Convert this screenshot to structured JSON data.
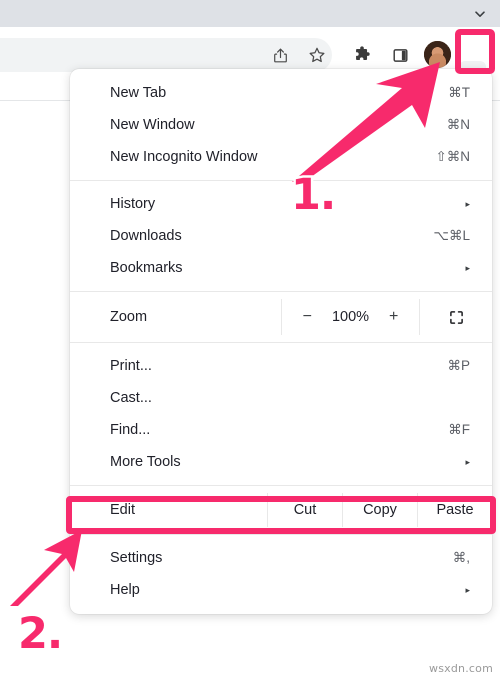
{
  "browser": {
    "tabstrip": {
      "chevron_icon": "chevron-down-icon"
    },
    "toolbar": {
      "icons": [
        {
          "name": "share-icon",
          "label": "Share"
        },
        {
          "name": "bookmark-star-icon",
          "label": "Bookmark this tab"
        },
        {
          "name": "extensions-puzzle-icon",
          "label": "Extensions"
        },
        {
          "name": "side-panel-icon",
          "label": "Side panel"
        }
      ],
      "avatar_label": "Profile",
      "menu_button_label": "Customize and control Google Chrome",
      "menu_button_icon": "three-dots-vertical-icon"
    }
  },
  "menu": {
    "groups": [
      {
        "items": [
          {
            "label": "New Tab",
            "accel": "⌘T",
            "caret": ""
          },
          {
            "label": "New Window",
            "accel": "⌘N",
            "caret": ""
          },
          {
            "label": "New Incognito Window",
            "accel": "⇧⌘N",
            "caret": ""
          }
        ]
      },
      {
        "items": [
          {
            "label": "History",
            "accel": "",
            "caret": "▸"
          },
          {
            "label": "Downloads",
            "accel": "⌥⌘L",
            "caret": ""
          },
          {
            "label": "Bookmarks",
            "accel": "",
            "caret": "▸"
          }
        ]
      }
    ],
    "zoom_row": {
      "label": "Zoom",
      "minus": "−",
      "value": "100%",
      "plus": "+",
      "fullscreen_icon": "fullscreen-icon"
    },
    "group3": {
      "items": [
        {
          "label": "Print...",
          "accel": "⌘P",
          "caret": ""
        },
        {
          "label": "Cast...",
          "accel": "",
          "caret": ""
        },
        {
          "label": "Find...",
          "accel": "⌘F",
          "caret": ""
        },
        {
          "label": "More Tools",
          "accel": "",
          "caret": "▸"
        }
      ]
    },
    "edit_row": {
      "label": "Edit",
      "cut": "Cut",
      "copy": "Copy",
      "paste": "Paste"
    },
    "group4": {
      "items": [
        {
          "label": "Settings",
          "accel": "⌘,",
          "caret": ""
        },
        {
          "label": "Help",
          "accel": "",
          "caret": "▸"
        }
      ]
    }
  },
  "annotations": {
    "accent_color": "#f72a6c",
    "step_one": "1.",
    "step_two": "2.",
    "highlight_one_target": "three-dots-menu-button",
    "highlight_two_target": "menu-item-settings"
  },
  "watermark": "wsxdn.com"
}
